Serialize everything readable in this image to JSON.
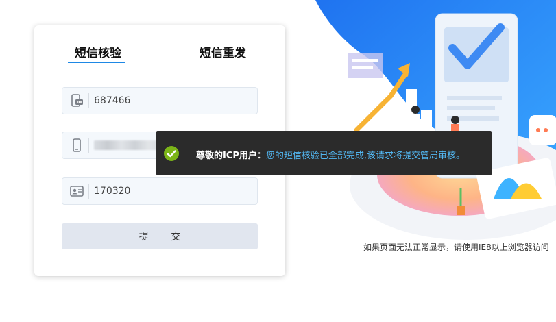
{
  "tabs": [
    {
      "label": "短信核验",
      "active": true
    },
    {
      "label": "短信重发",
      "active": false
    }
  ],
  "fields": {
    "sms_code": {
      "value": "687466",
      "icon": "sms-icon"
    },
    "phone": {
      "value": "",
      "icon": "phone-icon",
      "masked": true
    },
    "id_suffix": {
      "value": "170320",
      "icon": "id-card-icon"
    }
  },
  "submit_label": "提 交",
  "toast": {
    "lead": "尊敬的ICP用户：",
    "message": "您的短信核验已全部完成,该请求将提交管局审核。",
    "icon": "check-circle-icon"
  },
  "footer_note": "如果页面无法正常显示，请使用IE8以上浏览器访问",
  "colors": {
    "accent": "#1e88e5",
    "toast_bg": "#2b2b2b",
    "toast_link": "#52b6f0",
    "success": "#7cb518",
    "submit_bg": "#e1e6ef"
  }
}
